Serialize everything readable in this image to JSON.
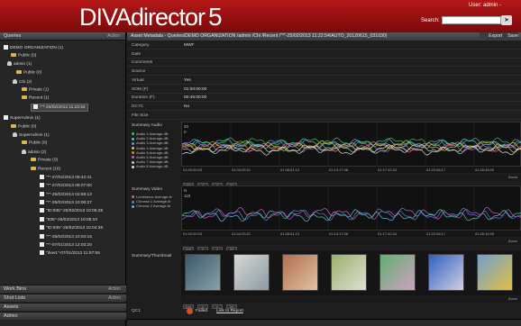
{
  "app": {
    "title": "DIVAdirector",
    "version": "5"
  },
  "header": {
    "user_label": "User: admin -",
    "search_label": "Search:",
    "search_value": "",
    "search_button_icon": "search-arrow-icon"
  },
  "left": {
    "queries_title": "Queries",
    "queries_action": "Action",
    "tree": [
      {
        "label": "DEMO ORGANIZATION (1)",
        "icon": "doc"
      },
      {
        "label": "Public (0)",
        "icon": "folder"
      },
      {
        "label": "admin (1)",
        "icon": "person"
      },
      {
        "label": "Public (0)",
        "icon": "folder"
      },
      {
        "label": "Chi (2)",
        "icon": "person"
      },
      {
        "label": "Private (1)",
        "icon": "folder"
      },
      {
        "label": "Recent (1)",
        "icon": "folder"
      },
      {
        "label": "*\"*-25/02/2013 11:22:54",
        "icon": "doc"
      },
      {
        "label": "SuperAdmin (1)",
        "icon": "doc"
      },
      {
        "label": "Public (0)",
        "icon": "folder"
      },
      {
        "label": "SuperAdmin (1)",
        "icon": "person"
      },
      {
        "label": "Public (0)",
        "icon": "folder"
      },
      {
        "label": "admin (2)",
        "icon": "person"
      },
      {
        "label": "Private (0)",
        "icon": "folder"
      },
      {
        "label": "Recent (10)",
        "icon": "folder"
      },
      {
        "label": "\"*\"-27/02/2013 09:42:41",
        "icon": "doc"
      },
      {
        "label": "\"*\"-27/02/2013 09:07:00",
        "icon": "doc"
      },
      {
        "label": "\"*\"-25/02/2013 03:59:13",
        "icon": "doc"
      },
      {
        "label": "\"*\"-25/02/2013 10:06:27",
        "icon": "doc"
      },
      {
        "label": "\"ID:935\"-25/02/2013 10:05:25",
        "icon": "doc"
      },
      {
        "label": "\"935\"-25/02/2013 10:05:10",
        "icon": "doc"
      },
      {
        "label": "\"ID:935\"-25/02/2013 10:04:26",
        "icon": "doc"
      },
      {
        "label": "\"*\"-25/02/2013 10:04:15",
        "icon": "doc"
      },
      {
        "label": "\"*\"-07/01/2013 12:03:20",
        "icon": "doc"
      },
      {
        "label": "\"dvw1\"-07/01/2013 11:57:55",
        "icon": "doc"
      }
    ],
    "footers": [
      {
        "label": "Work Bins",
        "action": "Action"
      },
      {
        "label": "Shot Lists",
        "action": "Action"
      },
      {
        "label": "Assets",
        "action": ""
      },
      {
        "label": "Admin",
        "action": ""
      }
    ]
  },
  "main": {
    "title": "Asset Metadata - Queries/DEMO ORGANIZATION /admin /Chi /Recent /\"*\"-25/02/2013 11:22:54/AUTO_20120615_031030)",
    "export_label": "Export",
    "save_label": "Save",
    "fields": [
      {
        "k": "Category",
        "v": "MWF"
      },
      {
        "k": "Date",
        "v": ""
      },
      {
        "k": "Comments",
        "v": ""
      },
      {
        "k": "Source",
        "v": ""
      },
      {
        "k": "Virtual",
        "v": "Yes"
      },
      {
        "k": "SOM (F)",
        "v": "01:00:00:00"
      },
      {
        "k": "Duration (F)",
        "v": "00:45:00:00"
      },
      {
        "k": "DCTC",
        "v": "No"
      },
      {
        "k": "File Size",
        "v": ""
      }
    ],
    "audio_label": "Summary Audio",
    "audio_legend": [
      "Audio 1 Average-dB",
      "Audio 2 Average-dB",
      "Audio 3 Average-dB",
      "Audio 4 Average-dB",
      "Audio 5 Average-dB",
      "Audio 6 Average-dB",
      "Audio 7 Average-dB",
      "Audio 8 Average-dB"
    ],
    "audio_colors": [
      "#3fbf5f",
      "#4fc0c8",
      "#6f8fe0",
      "#c8c84f",
      "#e07f3f",
      "#bf5fbf",
      "#9fe09f",
      "#dfdfdf"
    ],
    "video_label": "Summary Video",
    "video_legend": [
      "Luminance Average-lb",
      "Chroma U Average-lb",
      "Chroma V Average-lb"
    ],
    "video_colors": [
      "#c05fc0",
      "#5f7fd0",
      "#5fbfbf"
    ],
    "timecodes": [
      "01:00:00:03",
      "01:04:25:21",
      "01:08:51:13",
      "01:13:17:08",
      "01:17:42:24",
      "01:22:08:17",
      "01:26:34:09"
    ],
    "audio_axis": [
      "20",
      "0"
    ],
    "video_axis": [
      "N",
      "118"
    ],
    "thumb_label": "Summary/Thumbnail",
    "zoom_label": "Zoom",
    "ctrl_labels": [
      "<<<",
      "<",
      ">",
      ">>"
    ],
    "qc_label": "QC1",
    "qc_status": "Failed",
    "qc_link": "Link to Report"
  }
}
